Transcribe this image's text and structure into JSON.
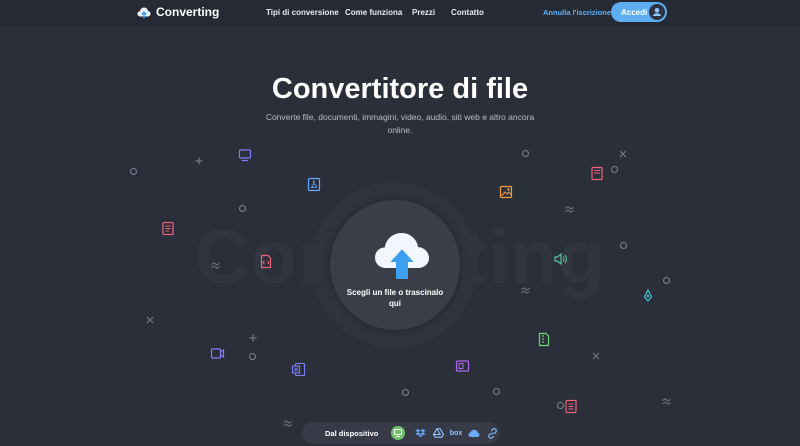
{
  "header": {
    "brand": "Converting",
    "nav": [
      "Tipi di conversione",
      "Come funziona",
      "Prezzi",
      "Contatto"
    ],
    "cancel_subscription": "Annulla l'iscrizione",
    "login": "Accedi"
  },
  "hero": {
    "title": "Convertitore di file",
    "subtitle": "Converte file, documenti, immagini, video, audio, siti web e altro ancora online.",
    "watermark": "Converting"
  },
  "upload": {
    "label": "Scegli un file o trascinalo qui"
  },
  "sources": {
    "label": "Dal dispositivo",
    "box_label": "box",
    "icons": [
      "device-icon",
      "dropbox-icon",
      "google-drive-icon",
      "box-icon",
      "onedrive-icon",
      "link-icon"
    ]
  },
  "colors": {
    "background": "#2b2f3a",
    "accent": "#5eaef2",
    "upload_arrow": "#3d9ff0",
    "device_green": "#6fc26a"
  }
}
